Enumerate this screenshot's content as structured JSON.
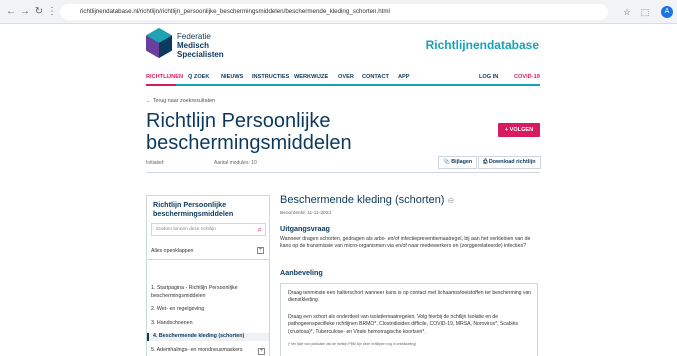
{
  "browser": {
    "url": "richtlijnendatabase.nl/richtlijn/richtlijn_persoonlijke_beschermingsmiddelen/beschermende_kleding_schorten.html",
    "avatar_letter": "A"
  },
  "header": {
    "logo_line1": "Federatie",
    "logo_line2": "Medisch",
    "logo_line3": "Specialisten",
    "site_title": "Richtlijnendatabase",
    "brand_color": "#0d3a5c",
    "accent_color": "#d81b60",
    "teal_color": "#17a2b8"
  },
  "nav": {
    "richtlijnen": "RICHTLIJNEN",
    "zoek": "Q ZOEK",
    "nieuws": "NIEUWS",
    "instructies": "INSTRUCTIES",
    "werkwijze": "WERKWIJZE",
    "over": "OVER",
    "contact": "CONTACT",
    "app": "APP",
    "login": "LOG IN",
    "covid": "COVID-19"
  },
  "page": {
    "back_link": "← Terug naar zoekresultaten",
    "title": "Richtlijn Persoonlijke beschermingsmiddelen",
    "follow_label": "+ VOLGEN",
    "initiatief_label": "Initiatief:",
    "aantal_label": "Aantal modules: 10",
    "bijlagen_label": "Bijlagen",
    "download_label": "Download richtlijn"
  },
  "sidebar": {
    "title": "Richtlijn Persoonlijke beschermingsmiddelen",
    "search_placeholder": "Zoeken binnen deze richtlijn",
    "expand_all": "Alles openklappen",
    "items": [
      {
        "label": "1.  Startpagina - Richtlijn Persoonlijke"
      },
      {
        "label": "     beschermingsmiddelen"
      },
      {
        "label": "2.  Wet- en regelgeving"
      },
      {
        "label": "3.  Handschoenen"
      },
      {
        "label": "4.  Beschermende kleding (schorten)"
      },
      {
        "label": "5.  Ademhalings- en mondneusmaskers"
      }
    ]
  },
  "content": {
    "title": "Beschermende kleding (schorten)",
    "anchor": "⊖",
    "date": "Beoordeeld: 11-11-2023",
    "uitgangsvraag_heading": "Uitgangsvraag",
    "uitgangsvraag_text": "Wanneer dragen schorten, gedragen als arbo- en/of infectiepreventiemaatregel, bij aan het verkleinen van de kans op de transmissie van micro-organismen via en/of naar medewerkers en (zorggerelateerde) infecties?",
    "aanbeveling_heading": "Aanbeveling",
    "reco_p1": "Draag tenminste een halterschort wanneer kans is op contact met lichaamsvloeistoffen ter bescherming van dienstkleding.",
    "reco_p2": "Draag een schort als onderdeel van isolatiemaatregelen. Volg hierbij de richtlijn Isolatie en de pathogeenspecifieke richtlijnen BRMO*, Clostridioides difficile, COVID-19, MRSA, Norovirus*, Scabiës (crustosa)*, Tuberculose- en Virale hemorragische koortsen*.",
    "reco_note": "(* ten tijde van publicatie van de richtlijn PBM zijn deze richtlijnen nog in ontwikkeling)"
  }
}
